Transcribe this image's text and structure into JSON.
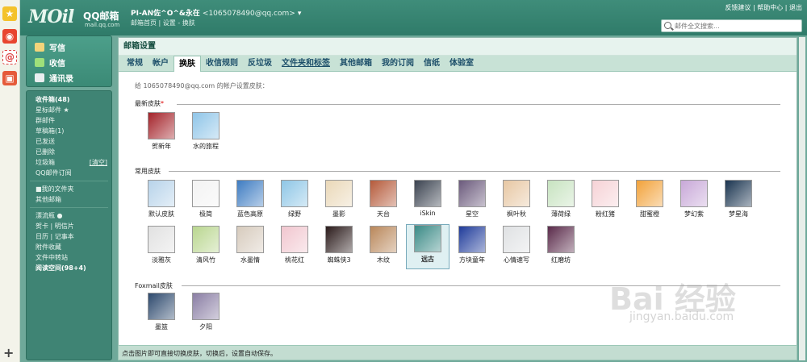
{
  "header": {
    "logo_text": "MOil",
    "logo_brand": "QQ邮箱",
    "logo_domain": "mail.qq.com",
    "user_name": "PI-AN佐^O^&永在",
    "user_email": "<1065078490@qq.com>",
    "sub_links": "邮箱首页 | 设置 - 换肤",
    "top_links": "反馈建议 | 帮助中心 | 退出",
    "search_placeholder": "邮件全文搜索..."
  },
  "sidebar": {
    "compose": [
      {
        "label": "写信",
        "icon": "pencil-icon"
      },
      {
        "label": "收信",
        "icon": "inbox-download-icon"
      },
      {
        "label": "通讯录",
        "icon": "contacts-icon"
      }
    ],
    "folders": [
      {
        "label": "收件箱(48)",
        "bold": true
      },
      {
        "label": "星标邮件 ★",
        "bold": false
      },
      {
        "label": "群邮件",
        "bold": false
      },
      {
        "label": "草稿箱(1)",
        "bold": false
      },
      {
        "label": "已发送",
        "bold": false
      },
      {
        "label": "已删除",
        "bold": false
      },
      {
        "label": "垃圾箱",
        "bold": false,
        "clear": "[清空]"
      },
      {
        "label": "QQ邮件订阅",
        "bold": false
      }
    ],
    "my_folders": [
      {
        "label": "■我的文件夹"
      },
      {
        "label": "其他邮箱"
      }
    ],
    "apps": [
      {
        "label": "漂流瓶 ●",
        "bold": false
      },
      {
        "label": "贺卡 | 明信片",
        "bold": false
      },
      {
        "label": "日历 | 记事本",
        "bold": false
      },
      {
        "label": "附件收藏",
        "bold": false
      },
      {
        "label": "文件中转站",
        "bold": false
      },
      {
        "label": "阅读空间(98+4)",
        "bold": true
      }
    ]
  },
  "main": {
    "title": "邮箱设置",
    "tabs": [
      {
        "label": "常规",
        "active": false
      },
      {
        "label": "帐户",
        "active": false
      },
      {
        "label": "换肤",
        "active": true
      },
      {
        "label": "收信规则",
        "active": false
      },
      {
        "label": "反垃圾",
        "active": false
      },
      {
        "label": "文件夹和标签",
        "active": false
      },
      {
        "label": "其他邮箱",
        "active": false
      },
      {
        "label": "我的订阅",
        "active": false
      },
      {
        "label": "信纸",
        "active": false
      },
      {
        "label": "体验室",
        "active": false
      }
    ],
    "hint": "给 1065078490@qq.com 的帐户设置皮肤：",
    "section_new": "最新皮肤",
    "section_new_star": "*",
    "section_common": "常用皮肤",
    "section_foxmail": "Foxmail皮肤",
    "new_skins": [
      {
        "label": "贺新年",
        "color": "#a4232a"
      },
      {
        "label": "水的旅程",
        "color": "#8fc5e8"
      }
    ],
    "common_skins_row1": [
      {
        "label": "默认皮肤",
        "color": "#b7d3ea"
      },
      {
        "label": "极简",
        "color": "#f3f3f3"
      },
      {
        "label": "蓝色高原",
        "color": "#3e7cc2"
      },
      {
        "label": "绿野",
        "color": "#8ec6e6"
      },
      {
        "label": "墨影",
        "color": "#ead8b8"
      },
      {
        "label": "天台",
        "color": "#b55a3a"
      },
      {
        "label": "iSkin",
        "color": "#3b4350"
      },
      {
        "label": "星空",
        "color": "#6b5a7c"
      },
      {
        "label": "枫叶秋",
        "color": "#e7c7a3"
      },
      {
        "label": "薄荷绿",
        "color": "#c7e3c0"
      },
      {
        "label": "粉红猪",
        "color": "#f6d2d6"
      },
      {
        "label": "甜蜜橙",
        "color": "#f2a23a"
      },
      {
        "label": "梦幻紫",
        "color": "#c8a8d8"
      },
      {
        "label": "梦星海",
        "color": "#1a3450"
      }
    ],
    "common_skins_row2": [
      {
        "label": "淡雅灰",
        "color": "#e1e1e1"
      },
      {
        "label": "清风竹",
        "color": "#b9d68f"
      },
      {
        "label": "水墨情",
        "color": "#d7cbbd"
      },
      {
        "label": "桃花红",
        "color": "#f1c6cf"
      },
      {
        "label": "蜘蛛侠3",
        "color": "#2a1a1a"
      },
      {
        "label": "木纹",
        "color": "#b9875a"
      },
      {
        "label": "远古",
        "color": "#3a8a86",
        "selected": true
      },
      {
        "label": "方块童年",
        "color": "#1f3b9a"
      },
      {
        "label": "心情速写",
        "color": "#dfe1e3"
      },
      {
        "label": "红磨坊",
        "color": "#5a2a4a"
      }
    ],
    "foxmail_skins": [
      {
        "label": "墨篮",
        "color": "#2e4a6e"
      },
      {
        "label": "夕阳",
        "color": "#8a7ea4"
      }
    ]
  },
  "footer": {
    "text": "点击图片即可直接切换皮肤，切换后，设置自动保存。"
  },
  "watermark": {
    "main": "Bai 经验",
    "sub": "jingyan.baidu.com"
  }
}
